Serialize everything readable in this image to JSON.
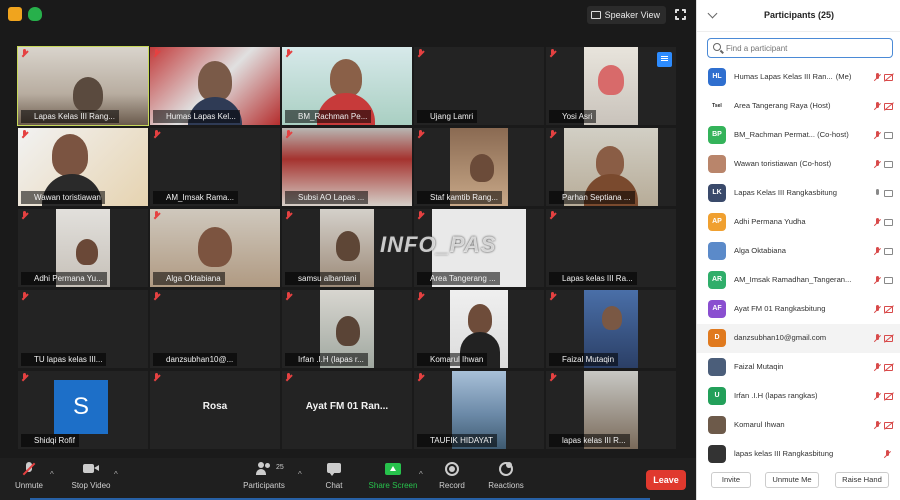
{
  "topbar": {
    "speaker_view_label": "Speaker View"
  },
  "tiles": [
    {
      "name": "Lapas Kelas III Rang..."
    },
    {
      "name": "Humas Lapas Kel..."
    },
    {
      "name": "BM_Rachman Pe..."
    },
    {
      "name": "Ujang Lamri"
    },
    {
      "name": "Yosi Asri"
    },
    {
      "name": "Wawan toristiawan"
    },
    {
      "name": "AM_Imsak Rama..."
    },
    {
      "name": "Subsi AO Lapas ..."
    },
    {
      "name": "Staf kamtib Rang..."
    },
    {
      "name": "Parhan Septiana ..."
    },
    {
      "name": "Adhi Permana Yu..."
    },
    {
      "name": "Alga Oktabiana"
    },
    {
      "name": "samsu albantani"
    },
    {
      "name": "Area Tangerang ..."
    },
    {
      "name": "Lapas kelas III Ra..."
    },
    {
      "name": "TU lapas kelas III..."
    },
    {
      "name": "danzsubhan10@..."
    },
    {
      "name": "Irfan .I.H (lapas r..."
    },
    {
      "name": "Komarul Ihwan"
    },
    {
      "name": "Faizal Mutaqin"
    },
    {
      "name": "Shidqi Rofif",
      "avatar": "S"
    },
    {
      "name": "",
      "center_name": "Rosa"
    },
    {
      "name": "",
      "center_name": "Ayat FM 01 Ran..."
    },
    {
      "name": "TAUFIK HIDAYAT"
    },
    {
      "name": "lapas kelas III R..."
    }
  ],
  "watermark": "INFO_PAS",
  "toolbar": {
    "unmute": "Unmute",
    "stop_video": "Stop Video",
    "participants": "Participants",
    "participants_count": "25",
    "chat": "Chat",
    "share_screen": "Share Screen",
    "record": "Record",
    "reactions": "Reactions",
    "leave": "Leave"
  },
  "panel": {
    "title": "Participants (25)",
    "search_placeholder": "Find a participant",
    "participants": [
      {
        "initials": "HL",
        "color": "#2f6fcf",
        "name": "Humas Lapas Kelas III Ran...",
        "suffix": "(Me)",
        "mic": "muted",
        "cam": "off"
      },
      {
        "initials": "Tsel",
        "color": "#ffffff",
        "name": "Area Tangerang Raya (Host)",
        "mic": "muted",
        "cam": "off"
      },
      {
        "initials": "BP",
        "color": "#34b35a",
        "name": "BM_Rachman Permat... (Co-host)",
        "mic": "muted",
        "cam": "on"
      },
      {
        "initials": "",
        "color": "#b9856b",
        "name": "Wawan toristiawan (Co-host)",
        "mic": "muted",
        "cam": "on"
      },
      {
        "initials": "LK",
        "color": "#3a4a6b",
        "name": "Lapas Kelas III Rangkasbitung",
        "mic": "on",
        "cam": "on"
      },
      {
        "initials": "AP",
        "color": "#f0a030",
        "name": "Adhi Permana Yudha",
        "mic": "muted",
        "cam": "on"
      },
      {
        "initials": "",
        "color": "#5b8ac9",
        "name": "Alga Oktabiana",
        "mic": "muted",
        "cam": "on"
      },
      {
        "initials": "AR",
        "color": "#2fae6a",
        "name": "AM_Imsak Ramadhan_Tangeran...",
        "mic": "muted",
        "cam": "on"
      },
      {
        "initials": "AF",
        "color": "#8a4fd0",
        "name": "Ayat FM 01 Rangkasbitung",
        "mic": "muted",
        "cam": "off"
      },
      {
        "initials": "D",
        "color": "#e07a1f",
        "name": "danzsubhan10@gmail.com",
        "mic": "muted",
        "cam": "off",
        "highlight": true
      },
      {
        "initials": "",
        "color": "#4b5e7a",
        "name": "Faizal Mutaqin",
        "mic": "muted",
        "cam": "off"
      },
      {
        "initials": "U",
        "color": "#23a05a",
        "name": "Irfan .I.H (lapas rangkas)",
        "mic": "muted",
        "cam": "off"
      },
      {
        "initials": "",
        "color": "#6d5a4a",
        "name": "Komarul Ihwan",
        "mic": "muted",
        "cam": "off"
      },
      {
        "initials": "",
        "color": "#333333",
        "name": "lapas kelas III Rangkasbitung",
        "mic": "muted",
        "cam": "none"
      }
    ],
    "footer": {
      "invite": "Invite",
      "unmute_me": "Unmute Me",
      "raise_hand": "Raise Hand"
    }
  }
}
